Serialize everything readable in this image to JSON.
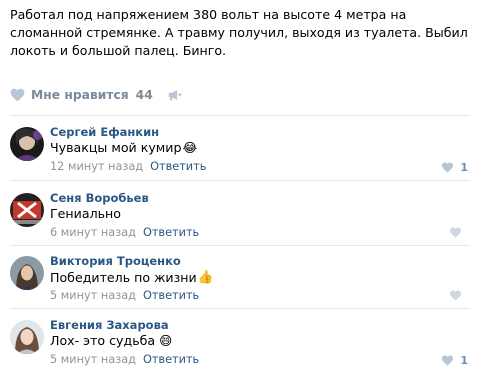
{
  "post": {
    "text": "Работал под напряжением 380 вольт на высоте 4 метра на сломанной стремянке. А травму получил, выходя из туалета. Выбил локоть и большой палец. Бинго."
  },
  "likes": {
    "label": "Мне нравится",
    "count": "44",
    "icon": "heart-icon",
    "share_icon": "megaphone-icon"
  },
  "comments": [
    {
      "author": "Сергей Ефанкин",
      "text": "Чувакцы мой кумир",
      "emoji": "😂",
      "time": "12 минут назад",
      "reply": "Ответить",
      "likes": "1"
    },
    {
      "author": "Сеня Воробьев",
      "text": "Гениально",
      "emoji": "",
      "time": "6 минут назад",
      "reply": "Ответить",
      "likes": ""
    },
    {
      "author": "Виктория Троценко",
      "text": "Победитель по жизни",
      "emoji": "👍",
      "time": "5 минут назад",
      "reply": "Ответить",
      "likes": ""
    },
    {
      "author": "Евгения Захарова",
      "text": "Лох- это судьба",
      "emoji": "😄",
      "time": "5 минут назад",
      "reply": "Ответить",
      "likes": "1"
    }
  ],
  "colors": {
    "link": "#2a5885",
    "muted": "#939393",
    "like_grey": "#7c8a9b",
    "divider": "#e7e8ec"
  }
}
